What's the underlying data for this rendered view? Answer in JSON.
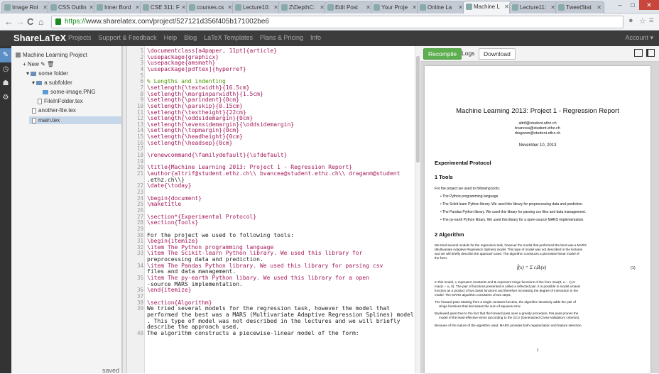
{
  "browser": {
    "tabs": [
      "Image Rot",
      "CSS Outlin",
      "Inner Bord",
      "CSE 311: F",
      "courses.cs",
      "Lecture10:",
      "Z\\DepthC:",
      "Edit Post",
      "Your Proje",
      "Online La",
      "Machine L",
      "Lecture11:",
      "TweetStat"
    ],
    "url_scheme": "https://",
    "url_rest": "www.sharelatex.com/project/527121d356f405b171002be6"
  },
  "nav": {
    "brand": "ShareLaTeX",
    "links": [
      "Projects",
      "Support & Feedback",
      "Help",
      "Blog",
      "LaTeX Templates",
      "Plans & Pricing",
      "Info"
    ],
    "account": "Account"
  },
  "tree": {
    "project": "Machine Learning Project",
    "new": "New",
    "items": [
      "some folder",
      "a subfolder",
      "some-image.PNG",
      "FileInFolder.tex",
      "another-file.tex",
      "main.tex"
    ],
    "saved": "saved"
  },
  "editor": {
    "lines": [
      {
        "n": "1",
        "t": "\\documentclass[a4paper, 11pt]{article}"
      },
      {
        "n": "2",
        "t": "\\usepackage{graphicx}"
      },
      {
        "n": "3",
        "t": "\\usepackage{amsmath}"
      },
      {
        "n": "4",
        "t": "\\usepackage[pdftex]{hyperref}"
      },
      {
        "n": "5",
        "t": ""
      },
      {
        "n": "6",
        "t": "% Lengths and indenting"
      },
      {
        "n": "7",
        "t": "\\setlength{\\textwidth}{16.5cm}"
      },
      {
        "n": "8",
        "t": "\\setlength{\\marginparwidth}{1.5cm}"
      },
      {
        "n": "9",
        "t": "\\setlength{\\parindent}{0cm}"
      },
      {
        "n": "10",
        "t": "\\setlength{\\parskip}{0.15cm}"
      },
      {
        "n": "11",
        "t": "\\setlength{\\textheight}{22cm}"
      },
      {
        "n": "12",
        "t": "\\setlength{\\oddsidemargin}{0cm}"
      },
      {
        "n": "13",
        "t": "\\setlength{\\evensidemargin}{\\oddsidemargin}"
      },
      {
        "n": "14",
        "t": "\\setlength{\\topmargin}{0cm}"
      },
      {
        "n": "15",
        "t": "\\setlength{\\headheight}{0cm}"
      },
      {
        "n": "16",
        "t": "\\setlength{\\headsep}{0cm}"
      },
      {
        "n": "17",
        "t": ""
      },
      {
        "n": "18",
        "t": "\\renewcommand{\\familydefault}{\\sfdefault}"
      },
      {
        "n": "19",
        "t": ""
      },
      {
        "n": "20",
        "t": "\\title{Machine Learning 2013: Project 1 - Regression Report}"
      },
      {
        "n": "21",
        "t": "\\author{altrif@student.ethz.ch\\\\ bvancea@student.ethz.ch\\\\ draganm@student"
      },
      {
        "n": "",
        "t": ".ethz.ch\\\\}"
      },
      {
        "n": "22",
        "t": "\\date{\\today}"
      },
      {
        "n": "23",
        "t": ""
      },
      {
        "n": "24",
        "t": "\\begin{document}"
      },
      {
        "n": "25",
        "t": "\\maketitle"
      },
      {
        "n": "26",
        "t": ""
      },
      {
        "n": "27",
        "t": "\\section*{Experimental Protocol}"
      },
      {
        "n": "28",
        "t": "\\section{Tools}"
      },
      {
        "n": "29",
        "t": ""
      },
      {
        "n": "30",
        "t": "For the project we used to following tools:"
      },
      {
        "n": "31",
        "t": "    \\begin{itemize}"
      },
      {
        "n": "32",
        "t": "        \\item The Python programming language"
      },
      {
        "n": "33",
        "t": "        \\item The Scikit-learn Python library. We used this library for"
      },
      {
        "n": "",
        "t": "preprocessing data and prediction."
      },
      {
        "n": "34",
        "t": "        \\item The Pandas Python library. We used this library for parsing csv"
      },
      {
        "n": "",
        "t": "files and data management."
      },
      {
        "n": "35",
        "t": "        \\item The py-earth Python libary. We used this library for a open"
      },
      {
        "n": "",
        "t": "-source MARS implementation."
      },
      {
        "n": "36",
        "t": "    \\end{itemize}"
      },
      {
        "n": "37",
        "t": ""
      },
      {
        "n": "38",
        "t": "\\section{Algorithm}"
      },
      {
        "n": "39",
        "t": "We tried several models for the regression task, however the model that"
      },
      {
        "n": "",
        "t": "performed the best was a MARS (Multivariate Adaptive Regression Splines) model"
      },
      {
        "n": "",
        "t": ". This type of model was not described in the lectures and we will briefly"
      },
      {
        "n": "",
        "t": "describe the approach used."
      },
      {
        "n": "40",
        "t": "The algorithm constructs a piecewise-linear model of the form:"
      }
    ]
  },
  "pdf": {
    "recompile": "Recompile",
    "logs": "Logs",
    "download": "Download",
    "title": "Machine Learning 2013: Project 1 - Regression Report",
    "authors": [
      "altrif@student.ethz.ch",
      "bvancea@student.ethz.ch",
      "draganm@student.ethz.ch"
    ],
    "date": "November 10, 2013",
    "sec_exp": "Experimental Protocol",
    "sec_tools": "1   Tools",
    "tools_intro": "For the project we used to following tools:",
    "bullets": [
      "The Python programming language",
      "The Scikit-learn Python library. We used this library for preprocessing data and prediction.",
      "The Pandas Python library. We used this library for parsing csv files and data management.",
      "The py-earth Python library. We used this library for a open-source MARS implementation."
    ],
    "sec_alg": "2   Algorithm",
    "alg_p1": [
      "We tried several models for the regression task, however the model that performed the best was a MARS",
      "(Multivariate Adaptive Regression Splines) model. This type of model was not described in the lectures",
      "and we will briefly describe the approach used. The algorithm constructs a piecewise-linear model of",
      "the form:"
    ],
    "formula": "f̂(x) = Σ cᵢBᵢ(x)",
    "eqnum": "(1)",
    "alg_p2": [
      "In this model, cᵢ represent constants and Bᵢ represent Hinge functions of the form max(0, xᵢ − c) or",
      "max(c − xᵢ, 0). The pair of functions presented is called a reflected pair. It is possible to model a basis",
      "function as a product of two basis functions and therefore increasing the degree of interaction in the",
      "model. The MARS algorithm consistens of two steps:"
    ],
    "fwd": [
      "The forward pass Starting from a single constant function, the algorithm iteratively adds the pair of",
      "Hinge functions that decreases the sum-of-squares error."
    ],
    "bwd": [
      "Backward pass Due to the fact that the forward pass uses a greedy procedure, this pass prunes the",
      "model of the least-effective terms (according to the GCV (Generalized Cross-Validation) criterion)."
    ],
    "closing": "Because of the nature of the algorithm used, MARS provides both regularization and feature selection.",
    "pagenum": "1"
  }
}
